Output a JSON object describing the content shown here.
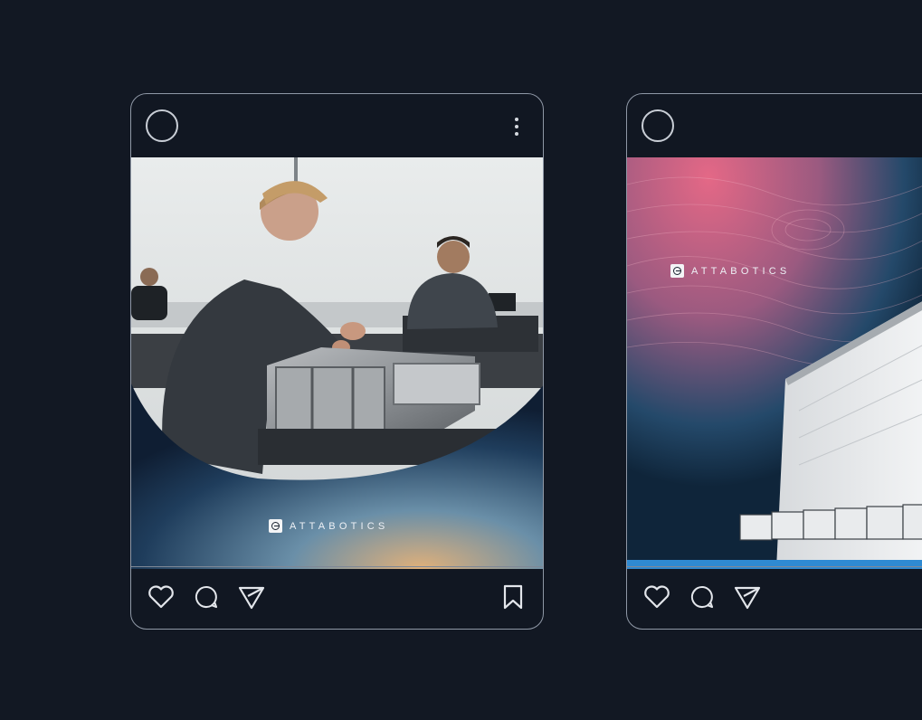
{
  "brand": {
    "name": "ATTABOTICS"
  },
  "colors": {
    "background": "#121823",
    "card_border": "#8f98a6",
    "icon_stroke": "#e3e6eb",
    "accent_blue": "#2f8ad2",
    "accent_pink": "#e46886"
  },
  "posts": [
    {
      "id": "post-1",
      "header": {
        "avatar_icon": "avatar-circle-icon",
        "menu_icon": "more-vertical-icon"
      },
      "media": {
        "logo_text": "ATTABOTICS"
      },
      "actions": [
        {
          "name": "like",
          "icon": "heart-icon"
        },
        {
          "name": "comment",
          "icon": "comment-icon"
        },
        {
          "name": "share",
          "icon": "send-icon"
        },
        {
          "name": "save",
          "icon": "bookmark-icon"
        }
      ]
    },
    {
      "id": "post-2",
      "header": {
        "avatar_icon": "avatar-circle-icon"
      },
      "media": {
        "logo_text": "ATTABOTICS"
      },
      "actions": [
        {
          "name": "like",
          "icon": "heart-icon"
        },
        {
          "name": "comment",
          "icon": "comment-icon"
        },
        {
          "name": "share",
          "icon": "send-icon"
        }
      ]
    }
  ]
}
